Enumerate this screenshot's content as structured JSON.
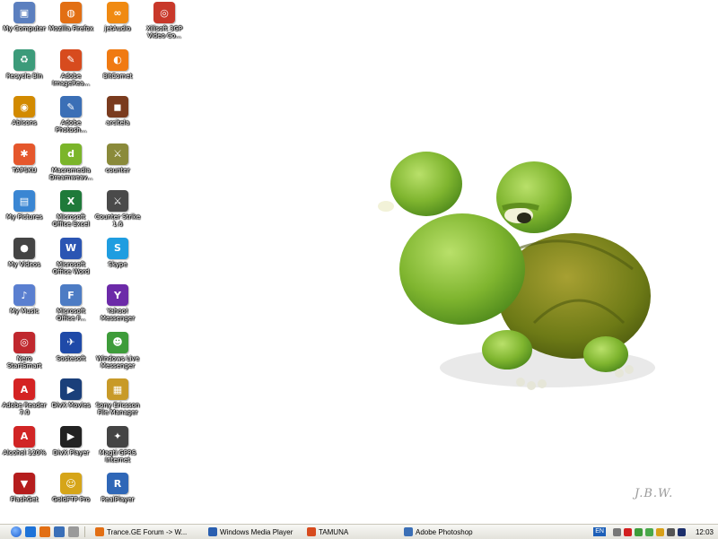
{
  "desktop": {
    "icons": [
      {
        "label": "My Computer",
        "icon": "my-computer-icon",
        "color": "#5b7fbf",
        "glyph": "▣"
      },
      {
        "label": "Recycle Bin",
        "icon": "recycle-bin-icon",
        "color": "#3c9b7a",
        "glyph": "♻"
      },
      {
        "label": "Abicons",
        "icon": "abicons-icon",
        "color": "#d28a00",
        "glyph": "◉"
      },
      {
        "label": "TAPSKU",
        "icon": "tapsku-icon",
        "color": "#e5572c",
        "glyph": "✱"
      },
      {
        "label": "My Pictures",
        "icon": "my-pictures-icon",
        "color": "#3a86d3",
        "glyph": "▤"
      },
      {
        "label": "My Videos",
        "icon": "my-videos-icon",
        "color": "#444444",
        "glyph": "●"
      },
      {
        "label": "My Music",
        "icon": "my-music-icon",
        "color": "#5a7fd0",
        "glyph": "♪"
      },
      {
        "label": "Nero StartSmart",
        "icon": "nero-icon",
        "color": "#c0282e",
        "glyph": "◎"
      },
      {
        "label": "Adobe Reader 7.0",
        "icon": "adobe-reader-icon",
        "color": "#d42323",
        "glyph": "A"
      },
      {
        "label": "Alcohol 120%",
        "icon": "alcohol-icon",
        "color": "#d12525",
        "glyph": "A"
      },
      {
        "label": "FlashGet",
        "icon": "flashget-icon",
        "color": "#b51d1d",
        "glyph": "▼"
      },
      {
        "label": "Mozilla Firefox",
        "icon": "firefox-icon",
        "color": "#e26f14",
        "glyph": "◍"
      },
      {
        "label": "Adobe ImageRea...",
        "icon": "imageready-icon",
        "color": "#d74b1e",
        "glyph": "✎"
      },
      {
        "label": "Adobe Photosh...",
        "icon": "photoshop-icon",
        "color": "#3b6fb6",
        "glyph": "✎"
      },
      {
        "label": "Macromedia Dreamweav...",
        "icon": "dreamweaver-icon",
        "color": "#7bb52a",
        "glyph": "d"
      },
      {
        "label": "Microsoft Office Excel",
        "icon": "excel-icon",
        "color": "#1f7a3a",
        "glyph": "X"
      },
      {
        "label": "Microsoft Office Word",
        "icon": "word-icon",
        "color": "#2b55b3",
        "glyph": "W"
      },
      {
        "label": "Microsoft Office F...",
        "icon": "frontpage-icon",
        "color": "#4d7cc4",
        "glyph": "F"
      },
      {
        "label": "Sostesoft",
        "icon": "sostesoft-icon",
        "color": "#1f4aa8",
        "glyph": "✈"
      },
      {
        "label": "DivX Movies",
        "icon": "divx-movies-icon",
        "color": "#1a3f7a",
        "glyph": "▶"
      },
      {
        "label": "DivX Player",
        "icon": "divx-player-icon",
        "color": "#222222",
        "glyph": "▶"
      },
      {
        "label": "GoldFTP Pro",
        "icon": "goldftp-icon",
        "color": "#d6a519",
        "glyph": "☺"
      },
      {
        "label": "jetAudio",
        "icon": "jetaudio-icon",
        "color": "#f08a12",
        "glyph": "∞"
      },
      {
        "label": "BitComet",
        "icon": "bitcomet-icon",
        "color": "#f07a12",
        "glyph": "◐"
      },
      {
        "label": "arcitela",
        "icon": "arcitela-icon",
        "color": "#7a3b1e",
        "glyph": "◼"
      },
      {
        "label": "counter",
        "icon": "counter-icon",
        "color": "#8a8a3a",
        "glyph": "⚔"
      },
      {
        "label": "Counter Strike 1.6",
        "icon": "counter-strike-icon",
        "color": "#4a4a4a",
        "glyph": "⚔"
      },
      {
        "label": "Skype",
        "icon": "skype-icon",
        "color": "#1f9de0",
        "glyph": "S"
      },
      {
        "label": "Yahoo! Messenger",
        "icon": "yahoo-messenger-icon",
        "color": "#6c2aa8",
        "glyph": "Y"
      },
      {
        "label": "Windows Live Messenger",
        "icon": "live-messenger-icon",
        "color": "#3e9c3a",
        "glyph": "☻"
      },
      {
        "label": "Sony Ericsson File Manager",
        "icon": "sony-ericsson-icon",
        "color": "#c89a28",
        "glyph": "▦"
      },
      {
        "label": "Magti GPRS Internet",
        "icon": "magti-icon",
        "color": "#444444",
        "glyph": "✦"
      },
      {
        "label": "RealPlayer",
        "icon": "realplayer-icon",
        "color": "#2f67b7",
        "glyph": "R"
      },
      {
        "label": "Xilisoft 3GP Video Co...",
        "icon": "xilisoft-icon",
        "color": "#c8382a",
        "glyph": "◎"
      }
    ],
    "watermark": "J.B.W."
  },
  "taskbar": {
    "tasks": [
      {
        "label": "Trance.GE Forum -> W...",
        "icon": "firefox-icon",
        "color": "#e26f14"
      },
      {
        "label": "Windows Media Player",
        "icon": "media-player-icon",
        "color": "#2a5fb0"
      },
      {
        "label": "TAMUNA",
        "icon": "imageready-icon",
        "color": "#d74b1e"
      },
      {
        "label": "Adobe Photoshop",
        "icon": "photoshop-icon",
        "color": "#3b6fb6"
      }
    ],
    "language": "EN",
    "clock": "12:03"
  }
}
